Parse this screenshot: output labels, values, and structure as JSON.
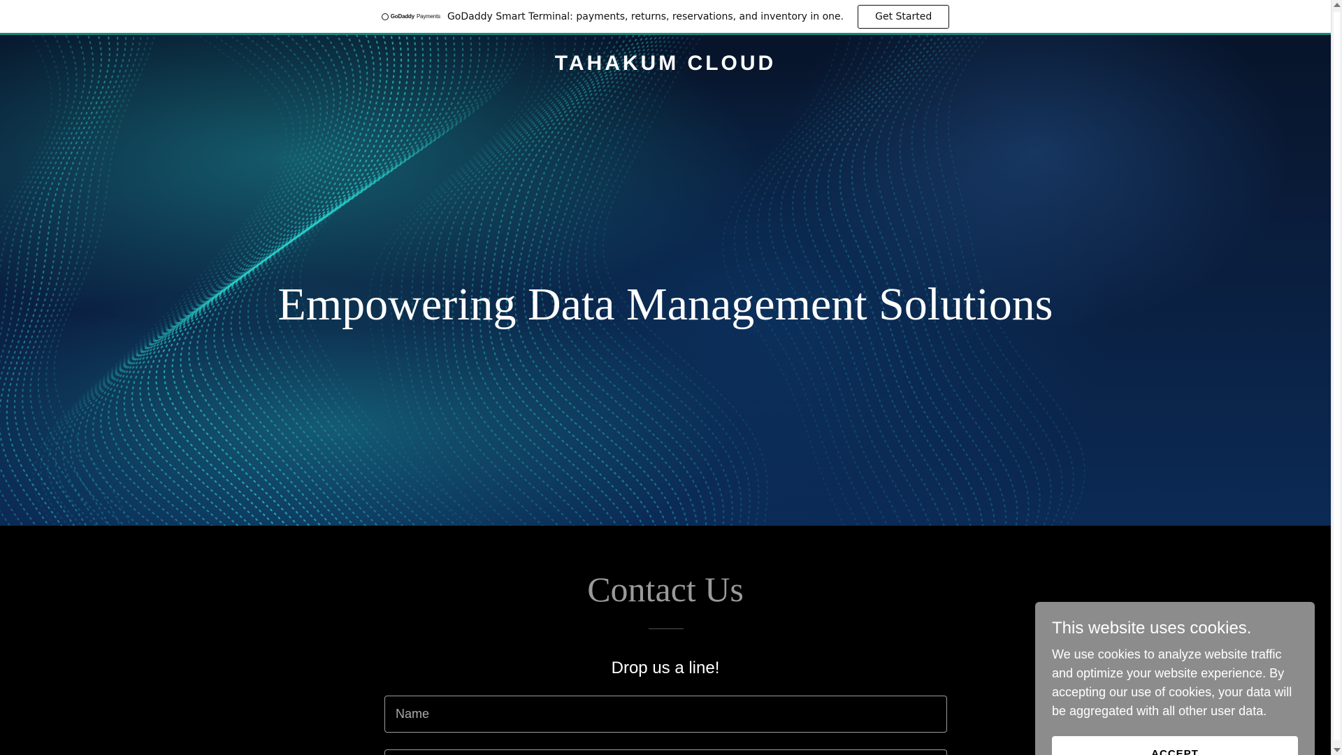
{
  "promo": {
    "logo_brand": "GoDaddy",
    "logo_product": "Payments",
    "text": "GoDaddy Smart Terminal: payments, returns, reservations, and inventory in one.",
    "cta_label": "Get Started"
  },
  "hero": {
    "site_title": "TAHAKUM CLOUD",
    "heading": "Empowering Data Management Solutions"
  },
  "contact": {
    "title": "Contact Us",
    "subtitle": "Drop us a line!",
    "name_placeholder": "Name",
    "email_placeholder": ""
  },
  "cookie": {
    "title": "This website uses cookies.",
    "text": "We use cookies to analyze website traffic and optimize your website experience. By accepting our use of cookies, your data will be aggregated with all other user data.",
    "accept_label": "ACCEPT"
  },
  "colors": {
    "banner_accent": "#16877f",
    "hero_bg": "#0a1d3c",
    "wave_cyan": "#2ad6cf",
    "cookie_bg": "#8c8c8c",
    "contact_bg": "#000000"
  }
}
